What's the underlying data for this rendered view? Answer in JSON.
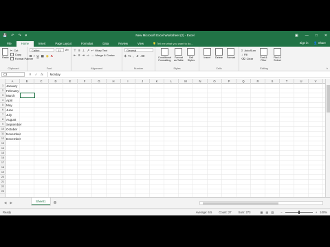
{
  "window": {
    "title": "New Microsoft Excel Worksheet (2) - Excel",
    "qat": [
      "save-icon",
      "undo-icon",
      "redo-icon",
      "customize-icon"
    ],
    "controls": [
      "ribbon-options-icon",
      "minimize-icon",
      "maximize-icon",
      "close-icon"
    ]
  },
  "tabs": [
    "File",
    "Home",
    "Insert",
    "Page Layout",
    "Formulas",
    "Data",
    "Review",
    "View"
  ],
  "active_tab": "Home",
  "tellme": "Tell me what you want to do...",
  "account": {
    "signin": "Sign in",
    "share": "Share"
  },
  "ribbon": {
    "clipboard": {
      "name": "Clipboard",
      "paste": "Paste",
      "cut": "Cut",
      "copy": "Copy",
      "painter": "Format Painter"
    },
    "font": {
      "name": "Font",
      "family": "Calibri",
      "size": "11"
    },
    "alignment": {
      "name": "Alignment",
      "wrap": "Wrap Text",
      "merge": "Merge & Center"
    },
    "number": {
      "name": "Number",
      "format": "General"
    },
    "styles": {
      "name": "Styles",
      "cond": "Conditional Formatting",
      "table": "Format as Table",
      "cell": "Cell Styles"
    },
    "cells": {
      "name": "Cells",
      "insert": "Insert",
      "delete": "Delete",
      "format": "Format"
    },
    "editing": {
      "name": "Editing",
      "autosum": "AutoSum",
      "fill": "Fill",
      "clear": "Clear",
      "sort": "Sort & Filter",
      "find": "Find & Select"
    }
  },
  "formula_bar": {
    "namebox": "C3",
    "content": "Monday"
  },
  "columns": [
    "A",
    "B",
    "C",
    "D",
    "E",
    "F",
    "G",
    "H",
    "I",
    "J",
    "K",
    "L",
    "M",
    "N",
    "O",
    "P",
    "Q",
    "R",
    "S",
    "T",
    "U",
    "V",
    "W"
  ],
  "rows": [
    "1",
    "2",
    "3",
    "4",
    "5",
    "6",
    "7",
    "8",
    "9",
    "10",
    "11",
    "12",
    "13",
    "14",
    "15",
    "16",
    "17",
    "18",
    "19",
    "20",
    "21",
    "22",
    "23"
  ],
  "cells_col_a": [
    "January",
    "February",
    "March",
    "April",
    "May",
    "June",
    "July",
    "August",
    "September",
    "October",
    "November",
    "December"
  ],
  "sheet_tab": "Sheet1",
  "status": {
    "mode": "Ready",
    "average": "Average: 6.5",
    "count": "Count: 27",
    "sum": "Sum: 273",
    "zoom": "100%"
  },
  "colors": {
    "accent": "#217346"
  }
}
